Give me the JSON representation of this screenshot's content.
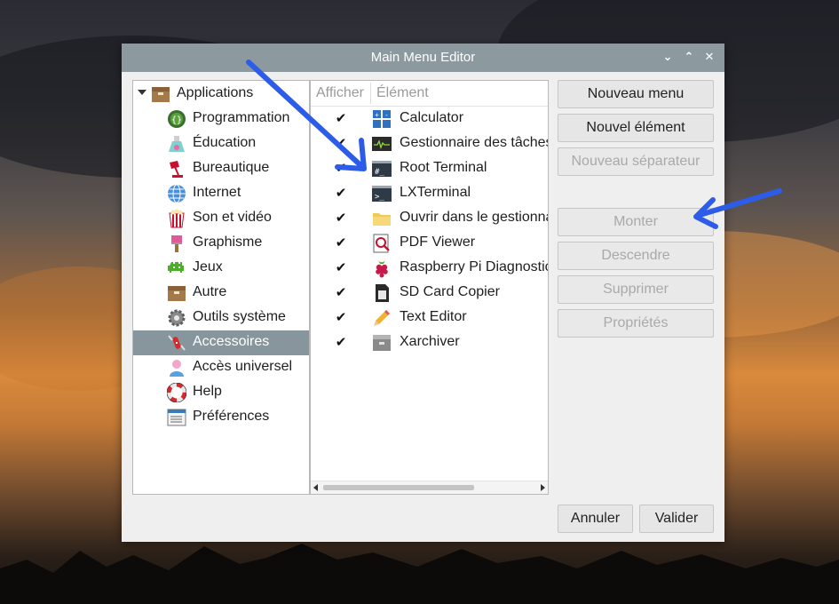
{
  "window": {
    "title": "Main Menu Editor",
    "controls": {
      "minimize": "⌄",
      "maximize": "⌃",
      "close": "✕"
    }
  },
  "tree": {
    "root": "Applications",
    "items": [
      {
        "label": "Programmation",
        "icon": "programming-icon"
      },
      {
        "label": "Éducation",
        "icon": "flask-icon"
      },
      {
        "label": "Bureautique",
        "icon": "desk-lamp-icon"
      },
      {
        "label": "Internet",
        "icon": "globe-icon"
      },
      {
        "label": "Son et vidéo",
        "icon": "popcorn-icon"
      },
      {
        "label": "Graphisme",
        "icon": "paintbrush-icon"
      },
      {
        "label": "Jeux",
        "icon": "space-invader-icon"
      },
      {
        "label": "Autre",
        "icon": "box-icon"
      },
      {
        "label": "Outils système",
        "icon": "gear-icon"
      },
      {
        "label": "Accessoires",
        "icon": "swiss-knife-icon",
        "selected": true
      },
      {
        "label": "Accès universel",
        "icon": "accessibility-person-icon"
      },
      {
        "label": "Help",
        "icon": "lifebuoy-icon"
      },
      {
        "label": "Préférences",
        "icon": "preferences-icon"
      }
    ]
  },
  "list": {
    "headers": {
      "show": "Afficher",
      "item": "Élément"
    },
    "rows": [
      {
        "label": "Calculator",
        "checked": true,
        "icon": "calculator-icon"
      },
      {
        "label": "Gestionnaire des tâches",
        "checked": true,
        "icon": "task-manager-icon"
      },
      {
        "label": "Root Terminal",
        "checked": true,
        "icon": "root-terminal-icon"
      },
      {
        "label": "LXTerminal",
        "checked": true,
        "icon": "terminal-icon"
      },
      {
        "label": "Ouvrir dans le gestionnaire",
        "checked": true,
        "icon": "folder-icon"
      },
      {
        "label": "PDF Viewer",
        "checked": true,
        "icon": "pdf-viewer-icon"
      },
      {
        "label": "Raspberry Pi Diagnostics",
        "checked": true,
        "icon": "raspberry-icon"
      },
      {
        "label": "SD Card Copier",
        "checked": true,
        "icon": "sd-card-icon"
      },
      {
        "label": "Text Editor",
        "checked": true,
        "icon": "pencil-icon"
      },
      {
        "label": "Xarchiver",
        "checked": true,
        "icon": "archive-icon"
      }
    ],
    "check_glyph": "✔"
  },
  "buttons": {
    "new_menu": "Nouveau menu",
    "new_item": "Nouvel élément",
    "new_separator": "Nouveau séparateur",
    "move_up": "Monter",
    "move_down": "Descendre",
    "delete": "Supprimer",
    "properties": "Propriétés",
    "cancel": "Annuler",
    "ok": "Valider"
  },
  "colors": {
    "titlebar": "#8c9a9f",
    "selection": "#87969c",
    "annotation_arrow": "#2d5de8"
  }
}
